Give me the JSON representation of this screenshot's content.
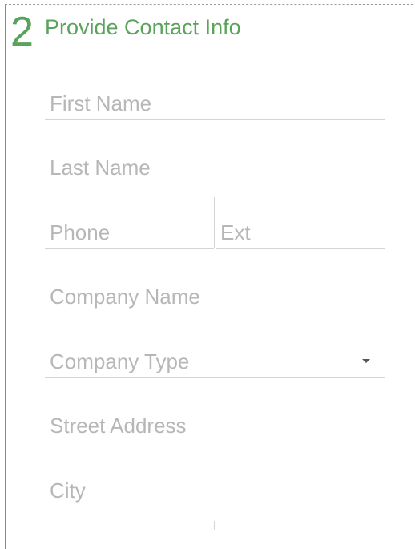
{
  "section": {
    "number": "2",
    "title": "Provide Contact Info"
  },
  "fields": {
    "first_name": {
      "placeholder": "First Name"
    },
    "last_name": {
      "placeholder": "Last Name"
    },
    "phone": {
      "placeholder": "Phone"
    },
    "ext": {
      "placeholder": "Ext"
    },
    "company_name": {
      "placeholder": "Company Name"
    },
    "company_type": {
      "placeholder": "Company Type"
    },
    "street_address": {
      "placeholder": "Street Address"
    },
    "city": {
      "placeholder": "City"
    }
  },
  "icons": {
    "company_type_dropdown": "caret-down-icon"
  },
  "colors": {
    "accent": "#5aa35a",
    "placeholder": "#b7b7b7",
    "divider": "#d4d4d4"
  }
}
